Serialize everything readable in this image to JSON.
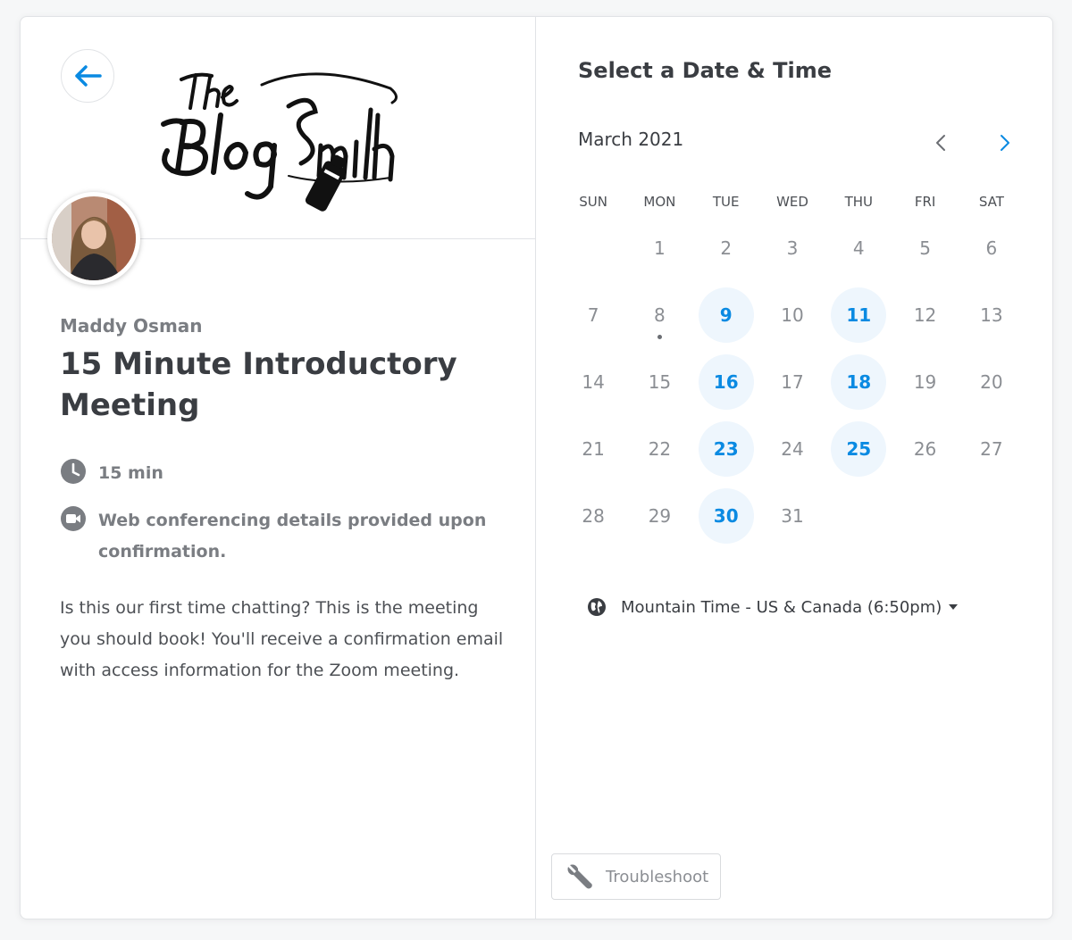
{
  "event": {
    "host_name": "Maddy Osman",
    "title": "15 Minute Introductory Meeting",
    "duration": "15 min",
    "conferencing": "Web conferencing details provided upon confirmation.",
    "description": "Is this our first time chatting? This is the meeting you should book! You'll receive a confirmation email with access information for the Zoom meeting.",
    "logo_text": "The BlogSmith"
  },
  "calendar": {
    "heading": "Select a Date & Time",
    "month_label": "March 2021",
    "weekdays": [
      "SUN",
      "MON",
      "TUE",
      "WED",
      "THU",
      "FRI",
      "SAT"
    ],
    "days": [
      "",
      "1",
      "2",
      "3",
      "4",
      "5",
      "6",
      "7",
      "8",
      "9",
      "10",
      "11",
      "12",
      "13",
      "14",
      "15",
      "16",
      "17",
      "18",
      "19",
      "20",
      "21",
      "22",
      "23",
      "24",
      "25",
      "26",
      "27",
      "28",
      "29",
      "30",
      "31"
    ],
    "available_days": [
      "9",
      "11",
      "16",
      "18",
      "23",
      "25",
      "30"
    ],
    "today": "8"
  },
  "timezone": {
    "label": "Mountain Time - US & Canada (6:50pm)"
  },
  "footer": {
    "troubleshoot_label": "Troubleshoot"
  },
  "colors": {
    "accent": "#0a8ae2",
    "available_bg": "#eef6fd"
  },
  "icons": {
    "back": "arrow-left-icon",
    "duration": "clock-icon",
    "conferencing": "video-camera-icon",
    "timezone": "globe-icon",
    "troubleshoot": "wrench-icon"
  }
}
